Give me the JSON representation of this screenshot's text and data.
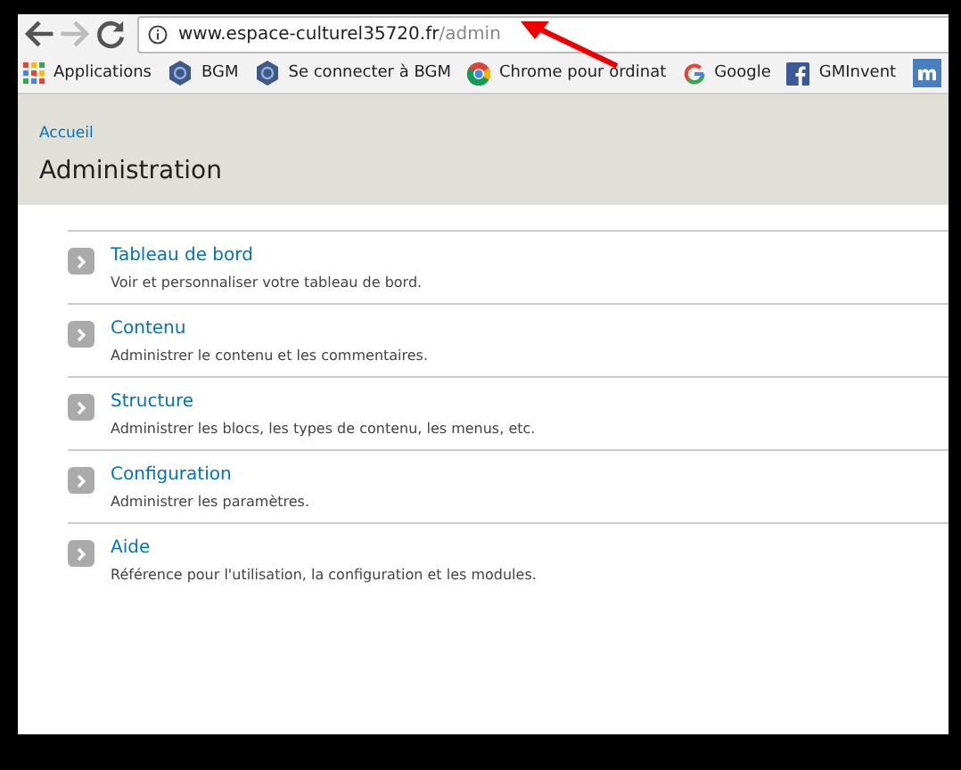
{
  "address_bar": {
    "host": "www.espace-culturel35720.fr",
    "path": "/admin",
    "back_disabled": false,
    "forward_disabled": true
  },
  "bookmarks": [
    {
      "label": "Applications",
      "kind": "apps"
    },
    {
      "label": "BGM",
      "kind": "hex"
    },
    {
      "label": "Se connecter à BGM",
      "kind": "hex"
    },
    {
      "label": "Chrome pour ordinat",
      "kind": "chrome"
    },
    {
      "label": "Google",
      "kind": "google"
    },
    {
      "label": "GMInvent",
      "kind": "facebook"
    },
    {
      "kind": "m"
    }
  ],
  "breadcrumb": "Accueil",
  "page_title": "Administration",
  "items": [
    {
      "title": "Tableau de bord",
      "description": "Voir et personnaliser votre tableau de bord."
    },
    {
      "title": "Contenu",
      "description": "Administrer le contenu et les commentaires."
    },
    {
      "title": "Structure",
      "description": "Administrer les blocs, les types de contenu, les menus, etc."
    },
    {
      "title": "Configuration",
      "description": "Administrer les paramètres."
    },
    {
      "title": "Aide",
      "description": "Référence pour l'utilisation, la configuration et les modules."
    }
  ],
  "annotation_arrow": true
}
